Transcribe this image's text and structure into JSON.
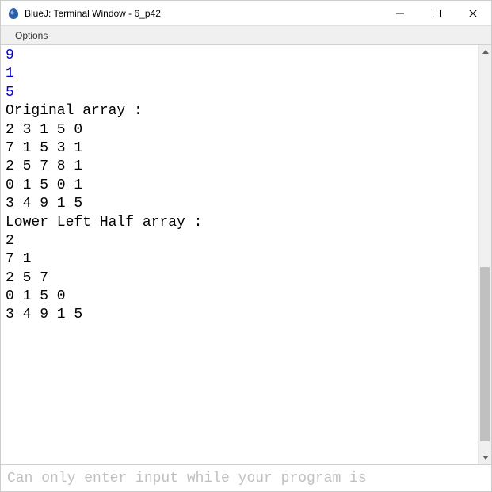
{
  "titlebar": {
    "title": "BlueJ: Terminal Window - 6_p42"
  },
  "menubar": {
    "options": "Options"
  },
  "terminal": {
    "input_lines": [
      "9",
      "1",
      "5"
    ],
    "output_lines": [
      "Original array :",
      "2 3 1 5 0",
      "7 1 5 3 1",
      "2 5 7 8 1",
      "0 1 5 0 1",
      "3 4 9 1 5",
      "Lower Left Half array :",
      "2",
      "7 1",
      "2 5 7",
      "0 1 5 0",
      "3 4 9 1 5"
    ]
  },
  "input_field": {
    "placeholder": "Can only enter input while your program is"
  }
}
